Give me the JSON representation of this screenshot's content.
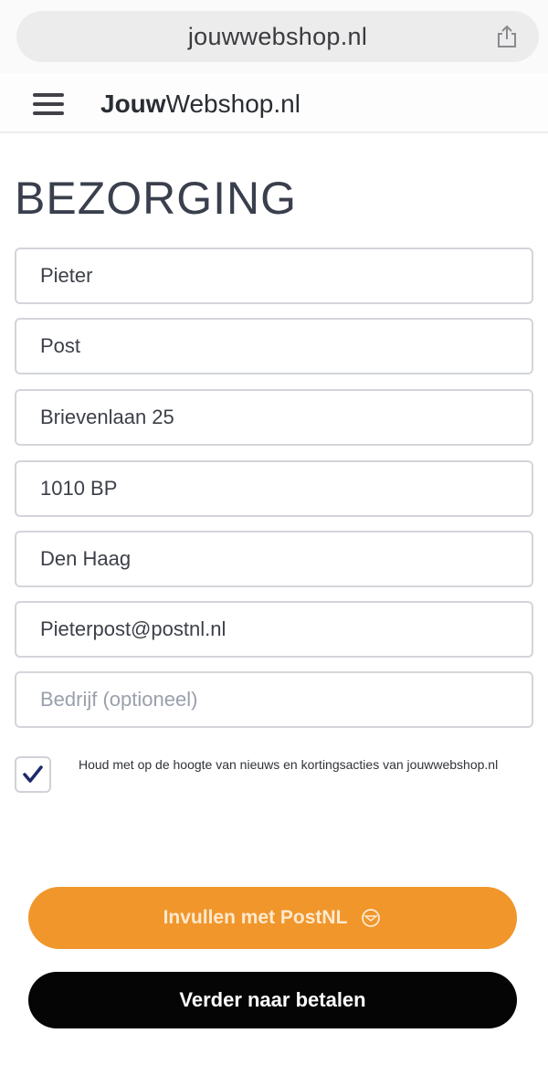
{
  "browser": {
    "url": "jouwwebshop.nl",
    "share_icon": "share-icon"
  },
  "header": {
    "menu_icon": "hamburger-menu-icon",
    "brand_bold": "Jouw",
    "brand_rest": "Webshop.nl"
  },
  "page": {
    "title": "BEZORGING"
  },
  "form": {
    "first_name": "Pieter",
    "last_name": "Post",
    "address": "Brievenlaan 25",
    "postcode": "1010 BP",
    "city": "Den Haag",
    "email": "Pieterpost@postnl.nl",
    "company_placeholder": "Bedrijf (optioneel)"
  },
  "newsletter": {
    "checked": true,
    "label": "Houd met op de hoogte van nieuws en kortingsacties van jouwwebshop.nl"
  },
  "actions": {
    "postnl_fill_label": "Invullen met PostNL",
    "postnl_icon": "postnl-icon",
    "continue_label": "Verder naar betalen"
  },
  "colors": {
    "accent_orange": "#f0962b",
    "primary_black": "#050505",
    "check_blue": "#1d2a6b"
  }
}
